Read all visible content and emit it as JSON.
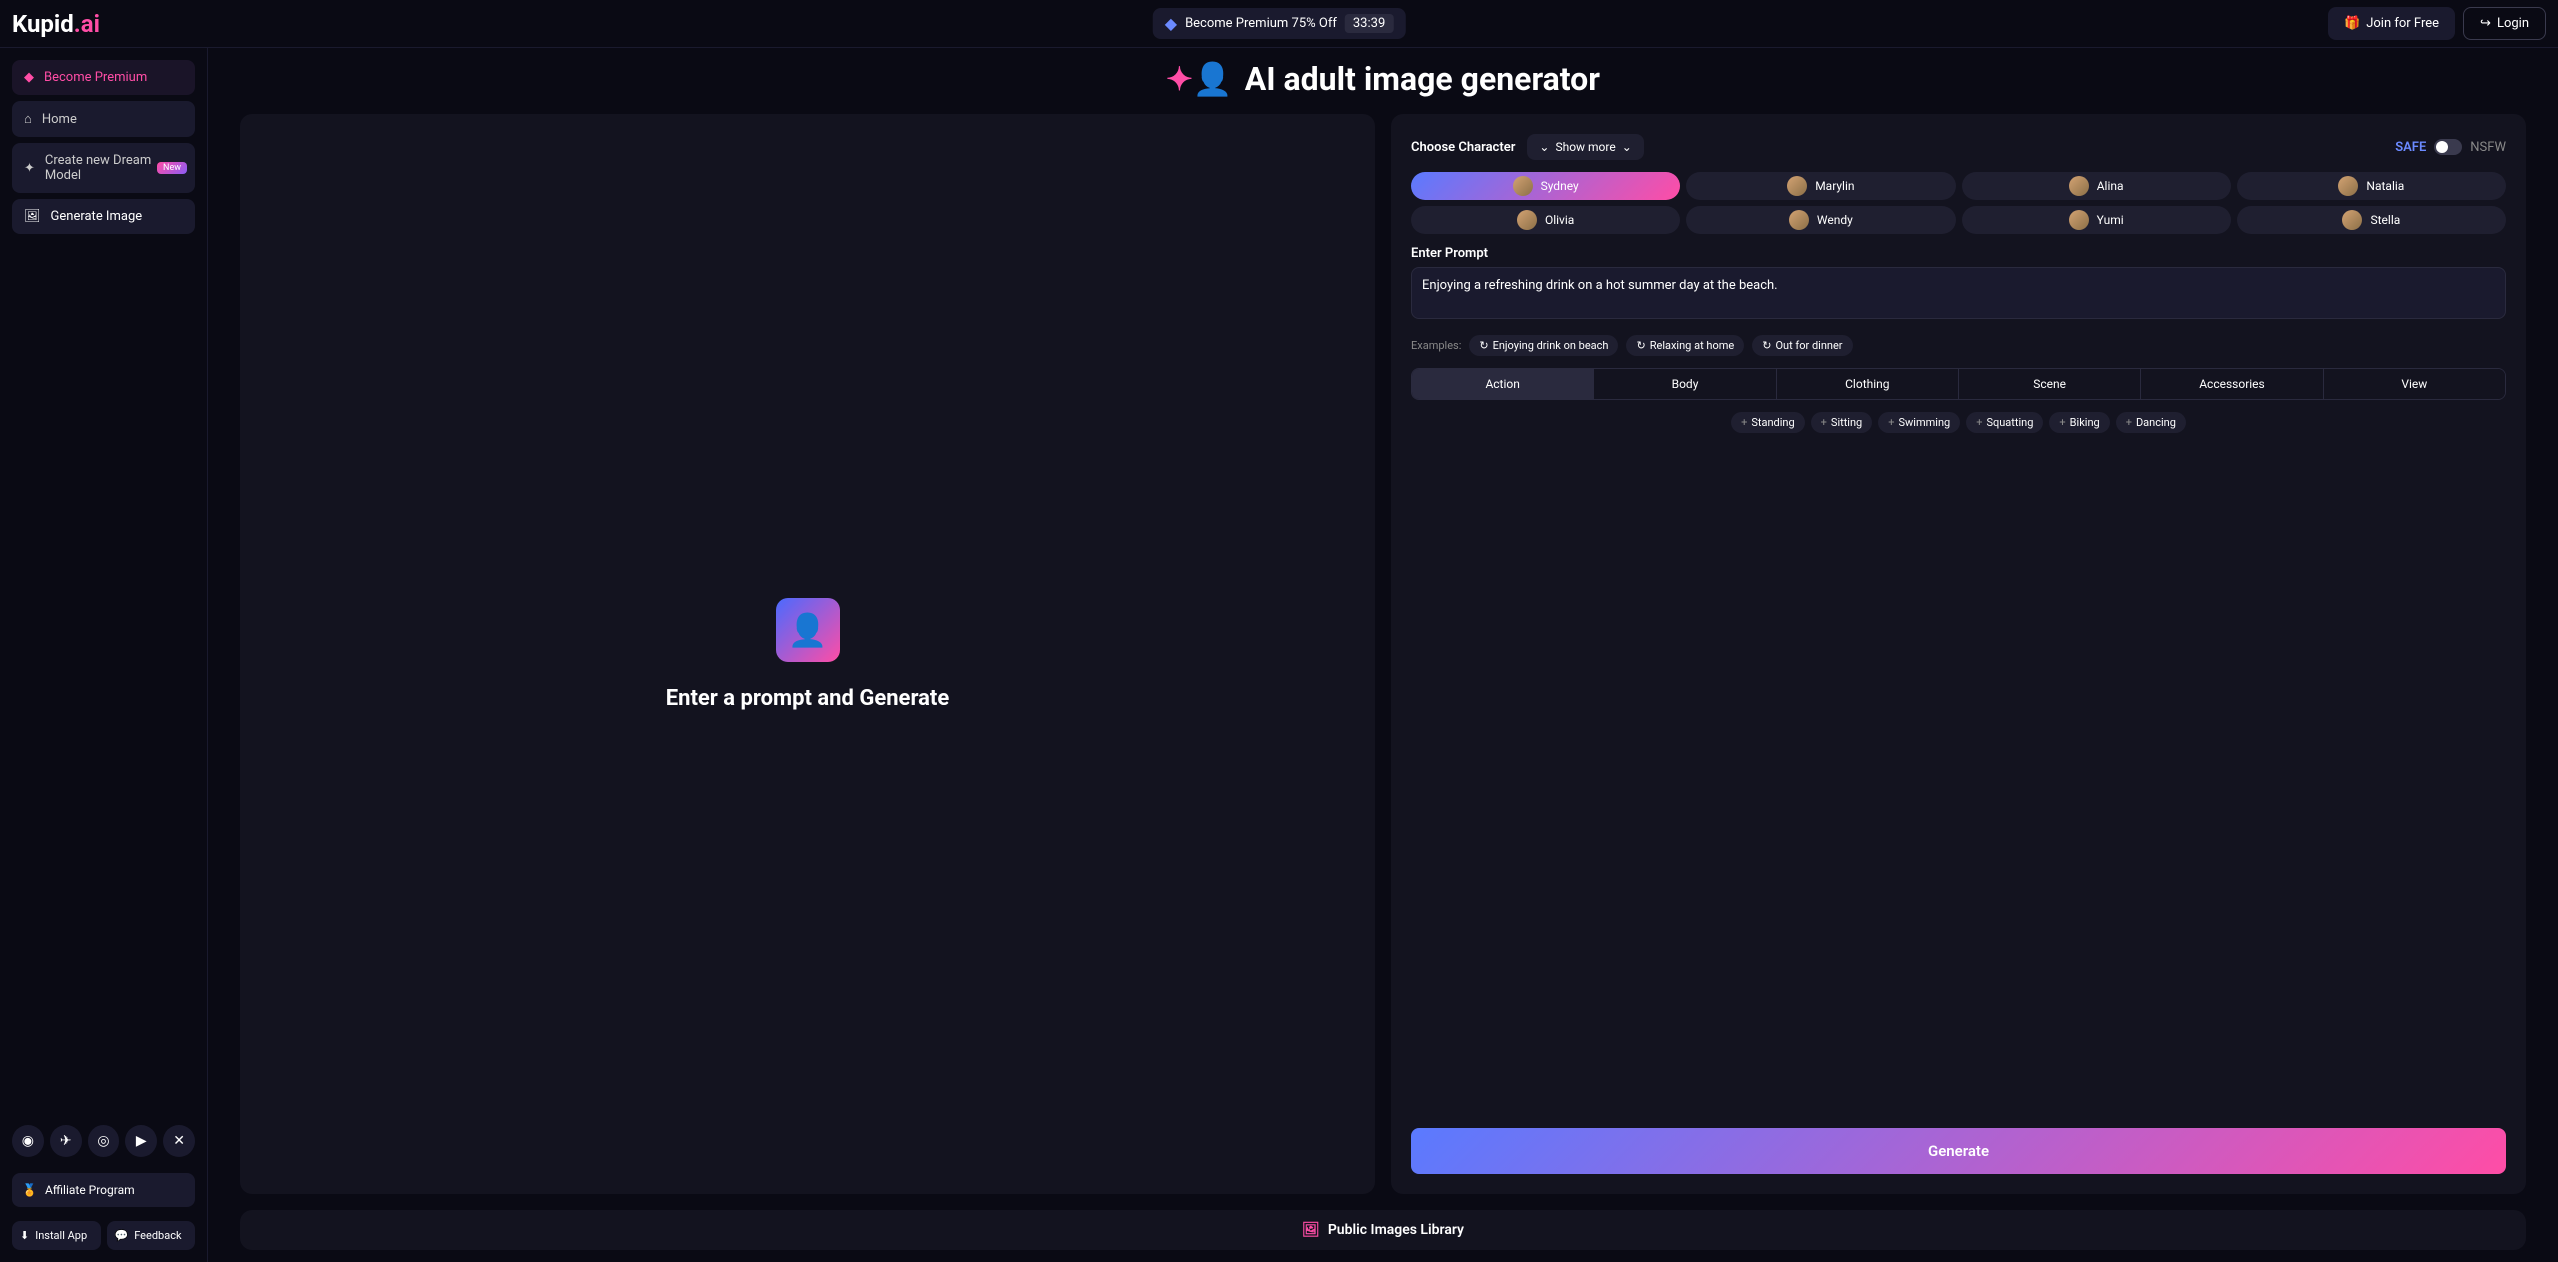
{
  "logo": {
    "brand": "Kupid",
    "suffix": ".ai"
  },
  "topbar": {
    "promo_text": "Become Premium 75% Off",
    "timer": "33:39",
    "join_label": "Join for Free",
    "login_label": "Login"
  },
  "sidebar": {
    "premium_label": "Become Premium",
    "items": [
      {
        "label": "Home"
      },
      {
        "label": "Create new Dream Model",
        "badge": "New"
      },
      {
        "label": "Generate Image"
      }
    ],
    "affiliate_label": "Affiliate Program",
    "install_label": "Install App",
    "feedback_label": "Feedback"
  },
  "page": {
    "title": "AI adult image generator"
  },
  "left_panel": {
    "placeholder": "Enter a prompt and Generate"
  },
  "right_panel": {
    "choose_label": "Choose Character",
    "show_more_label": "Show more",
    "safe_label": "SAFE",
    "nsfw_label": "NSFW",
    "characters_row1": [
      {
        "name": "Sydney",
        "selected": true
      },
      {
        "name": "Marylin"
      },
      {
        "name": "Alina"
      },
      {
        "name": "Natalia"
      }
    ],
    "characters_row2": [
      {
        "name": "Olivia"
      },
      {
        "name": "Wendy"
      },
      {
        "name": "Yumi"
      },
      {
        "name": "Stella"
      }
    ],
    "prompt_label": "Enter Prompt",
    "prompt_value": "Enjoying a refreshing drink on a hot summer day at the beach.",
    "examples_label": "Examples:",
    "examples": [
      "Enjoying drink on beach",
      "Relaxing at home",
      "Out for dinner"
    ],
    "categories": [
      "Action",
      "Body",
      "Clothing",
      "Scene",
      "Accessories",
      "View"
    ],
    "active_category": 0,
    "tags": [
      "Standing",
      "Sitting",
      "Swimming",
      "Squatting",
      "Biking",
      "Dancing"
    ],
    "generate_label": "Generate"
  },
  "footer": {
    "library_label": "Public Images Library"
  }
}
